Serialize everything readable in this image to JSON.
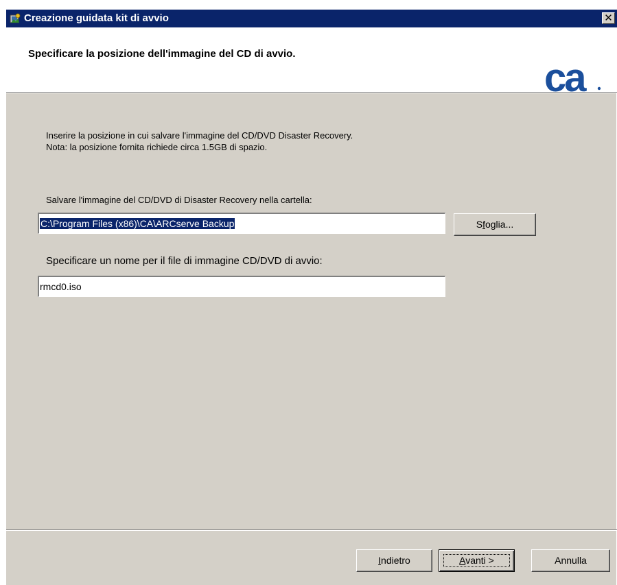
{
  "window": {
    "title": "Creazione guidata kit di avvio",
    "close_glyph": "✕"
  },
  "header": {
    "title": "Specificare la posizione dell'immagine del CD di avvio.",
    "logo_text": "ca",
    "logo_color": "#1b4f9c"
  },
  "intro": {
    "line1": "Inserire la posizione in cui salvare l'immagine del CD/DVD Disaster Recovery.",
    "line2": "Nota: la posizione fornita richiede circa 1.5GB di spazio."
  },
  "folder": {
    "label": "Salvare l'immagine del CD/DVD di Disaster Recovery nella cartella:",
    "value": "C:\\Program Files (x86)\\CA\\ARCserve Backup",
    "browse_prefix": "S",
    "browse_accel": "f",
    "browse_rest": "oglia..."
  },
  "filename": {
    "label": "Specificare un nome per il file di immagine CD/DVD di avvio:",
    "value": "rmcd0.iso"
  },
  "buttons": {
    "back_accel": "I",
    "back_rest": "ndietro",
    "next_accel": "A",
    "next_rest": "vanti >",
    "cancel": "Annulla"
  },
  "colors": {
    "titlebar": "#0a246a",
    "dialog_bg": "#d4d0c8",
    "selection": "#0a246a"
  },
  "icons": {
    "title": "wizard-app-icon",
    "logo": "ca-logo"
  }
}
